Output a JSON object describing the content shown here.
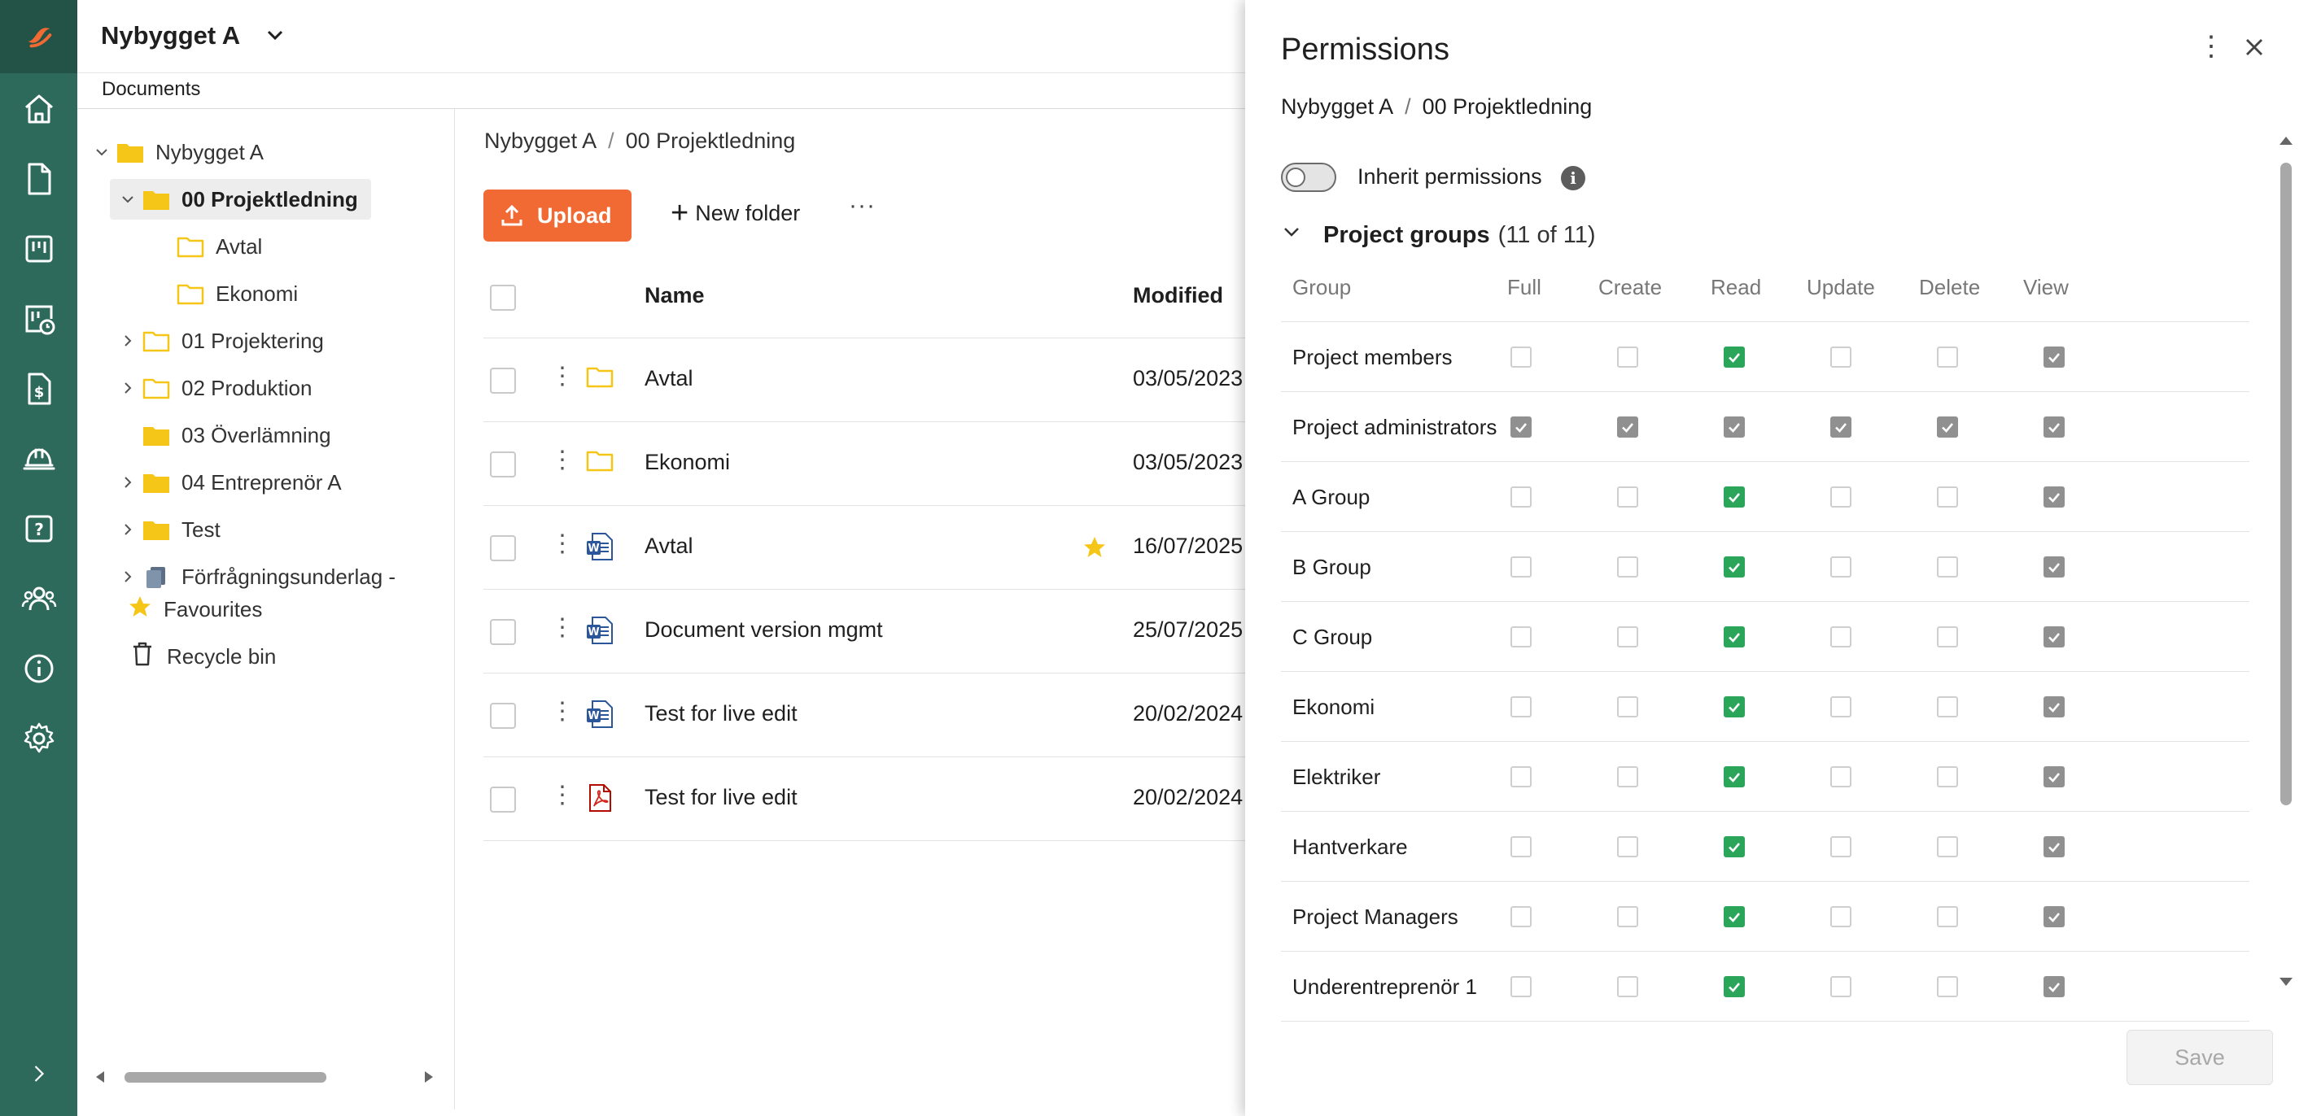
{
  "header": {
    "project_title": "Nybygget A",
    "section_label": "Documents"
  },
  "rail": {
    "icons": [
      "logo-icon",
      "home-icon",
      "document-icon",
      "board-icon",
      "board-clock-icon",
      "invoice-icon",
      "hard-hat-icon",
      "help-icon",
      "users-icon",
      "info-icon",
      "settings-icon",
      "expand-icon"
    ]
  },
  "tree": {
    "items": [
      {
        "label": "Nybygget A",
        "level": 0,
        "expander": "down",
        "icon": "folder"
      },
      {
        "label": "00 Projektledning",
        "level": 1,
        "expander": "down",
        "icon": "folder",
        "selected": true
      },
      {
        "label": "Avtal",
        "level": 2,
        "expander": "none",
        "icon": "folder-outline"
      },
      {
        "label": "Ekonomi",
        "level": 2,
        "expander": "none",
        "icon": "folder-outline"
      },
      {
        "label": "01 Projektering",
        "level": 1,
        "expander": "right",
        "icon": "folder-outline"
      },
      {
        "label": "02 Produktion",
        "level": 1,
        "expander": "right",
        "icon": "folder-outline"
      },
      {
        "label": "03 Överlämning",
        "level": 1,
        "expander": "none",
        "icon": "folder"
      },
      {
        "label": "04 Entreprenör A",
        "level": 1,
        "expander": "right",
        "icon": "folder"
      },
      {
        "label": "Test",
        "level": 1,
        "expander": "right",
        "icon": "folder"
      },
      {
        "label": "Förfrågningsunderlag -",
        "level": 1,
        "expander": "right",
        "icon": "files"
      }
    ],
    "favourites": "Favourites",
    "recycle": "Recycle bin"
  },
  "main": {
    "breadcrumb": [
      "Nybygget A",
      "00 Projektledning"
    ],
    "upload_label": "Upload",
    "new_folder_label": "New folder",
    "more_label": "···",
    "columns": {
      "name": "Name",
      "modified": "Modified"
    },
    "files": [
      {
        "name": "Avtal",
        "type": "folder",
        "modified": "03/05/2023",
        "starred": false
      },
      {
        "name": "Ekonomi",
        "type": "folder",
        "modified": "03/05/2023",
        "starred": false
      },
      {
        "name": "Avtal",
        "type": "word",
        "modified": "16/07/2025",
        "starred": true
      },
      {
        "name": "Document version mgmt",
        "type": "word",
        "modified": "25/07/2025",
        "starred": false
      },
      {
        "name": "Test for live edit",
        "type": "word",
        "modified": "20/02/2024",
        "starred": false
      },
      {
        "name": "Test for live edit",
        "type": "pdf",
        "modified": "20/02/2024",
        "starred": false
      }
    ]
  },
  "permissions": {
    "title": "Permissions",
    "breadcrumb": [
      "Nybygget A",
      "00 Projektledning"
    ],
    "inherit_label": "Inherit permissions",
    "inherit_enabled": false,
    "groups_title": "Project groups",
    "groups_count": "(11 of 11)",
    "columns": [
      "Group",
      "Full",
      "Create",
      "Read",
      "Update",
      "Delete",
      "View"
    ],
    "rows": [
      {
        "group": "Project members",
        "perms": [
          "off",
          "off",
          "green",
          "off",
          "off",
          "grey"
        ]
      },
      {
        "group": "Project administrators",
        "perms": [
          "grey",
          "grey",
          "grey",
          "grey",
          "grey",
          "grey"
        ]
      },
      {
        "group": "A Group",
        "perms": [
          "off",
          "off",
          "green",
          "off",
          "off",
          "grey"
        ]
      },
      {
        "group": "B Group",
        "perms": [
          "off",
          "off",
          "green",
          "off",
          "off",
          "grey"
        ]
      },
      {
        "group": "C Group",
        "perms": [
          "off",
          "off",
          "green",
          "off",
          "off",
          "grey"
        ]
      },
      {
        "group": "Ekonomi",
        "perms": [
          "off",
          "off",
          "green",
          "off",
          "off",
          "grey"
        ]
      },
      {
        "group": "Elektriker",
        "perms": [
          "off",
          "off",
          "green",
          "off",
          "off",
          "grey"
        ]
      },
      {
        "group": "Hantverkare",
        "perms": [
          "off",
          "off",
          "green",
          "off",
          "off",
          "grey"
        ]
      },
      {
        "group": "Project Managers",
        "perms": [
          "off",
          "off",
          "green",
          "off",
          "off",
          "grey"
        ]
      },
      {
        "group": "Underentreprenör 1",
        "perms": [
          "off",
          "off",
          "green",
          "off",
          "off",
          "grey"
        ]
      }
    ],
    "save_label": "Save"
  },
  "colors": {
    "rail": "#2d6a5c",
    "accent": "#f26a33",
    "folder": "#f5c518",
    "check_green": "#2aa55a",
    "check_grey": "#909090"
  }
}
